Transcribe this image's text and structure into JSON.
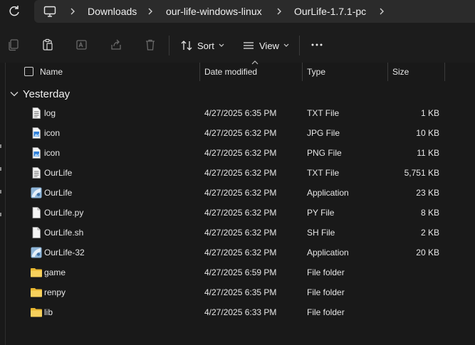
{
  "address": {
    "breadcrumbs": [
      "Downloads",
      "our-life-windows-linux",
      "OurLife-1.7.1-pc"
    ]
  },
  "toolbar": {
    "sort_label": "Sort",
    "view_label": "View"
  },
  "columns": {
    "name": "Name",
    "date": "Date modified",
    "type": "Type",
    "size": "Size"
  },
  "group": {
    "label": "Yesterday"
  },
  "files": [
    {
      "name": "log",
      "date": "4/27/2025 6:35 PM",
      "type": "TXT File",
      "size": "1 KB",
      "icon": "text-file-icon"
    },
    {
      "name": "icon",
      "date": "4/27/2025 6:32 PM",
      "type": "JPG File",
      "size": "10 KB",
      "icon": "image-file-icon"
    },
    {
      "name": "icon",
      "date": "4/27/2025 6:32 PM",
      "type": "PNG File",
      "size": "11 KB",
      "icon": "image-file-icon"
    },
    {
      "name": "OurLife",
      "date": "4/27/2025 6:32 PM",
      "type": "TXT File",
      "size": "5,751 KB",
      "icon": "text-file-icon"
    },
    {
      "name": "OurLife",
      "date": "4/27/2025 6:32 PM",
      "type": "Application",
      "size": "23 KB",
      "icon": "application-icon"
    },
    {
      "name": "OurLife.py",
      "date": "4/27/2025 6:32 PM",
      "type": "PY File",
      "size": "8 KB",
      "icon": "blank-file-icon"
    },
    {
      "name": "OurLife.sh",
      "date": "4/27/2025 6:32 PM",
      "type": "SH File",
      "size": "2 KB",
      "icon": "blank-file-icon"
    },
    {
      "name": "OurLife-32",
      "date": "4/27/2025 6:32 PM",
      "type": "Application",
      "size": "20 KB",
      "icon": "application-icon"
    },
    {
      "name": "game",
      "date": "4/27/2025 6:59 PM",
      "type": "File folder",
      "size": "",
      "icon": "folder-icon"
    },
    {
      "name": "renpy",
      "date": "4/27/2025 6:35 PM",
      "type": "File folder",
      "size": "",
      "icon": "folder-icon"
    },
    {
      "name": "lib",
      "date": "4/27/2025 6:33 PM",
      "type": "File folder",
      "size": "",
      "icon": "folder-icon"
    }
  ],
  "colors": {
    "background": "#191919",
    "address_box": "#2b2b2b",
    "folder": "#f2c94c",
    "text": "#e6e6e6"
  }
}
